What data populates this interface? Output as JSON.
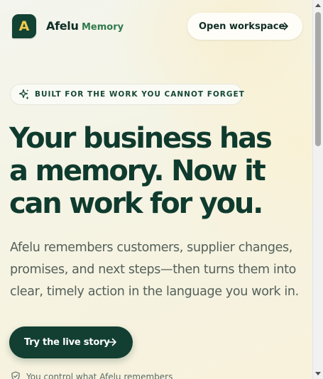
{
  "header": {
    "logo_letter": "A",
    "brand_name": "Afelu",
    "brand_sub": "Memory",
    "open_workspace_label": "Open workspace",
    "open_workspace_icon": "arrow-right-icon"
  },
  "badge": {
    "icon": "sparkle-icon",
    "text": "BUILT FOR THE WORK YOU CANNOT FORGET"
  },
  "hero": {
    "headline_lines": [
      "Your business has",
      "a memory. Now it",
      "can work for you."
    ],
    "lede_lines": [
      "Afelu remembers customers, supplier changes,",
      "promises, and next steps—then turns them into",
      "clear, timely action in the language you work in."
    ],
    "cta_label": "Try the live story",
    "cta_icon": "arrow-right-icon"
  },
  "privacy": {
    "icon": "shield-check-icon",
    "text": "You control what Afelu remembers"
  },
  "colors": {
    "brand_dark": "#123f31",
    "brand_accent": "#f1c84b",
    "brand_green": "#2f7a4c",
    "body_text": "#53605a"
  }
}
